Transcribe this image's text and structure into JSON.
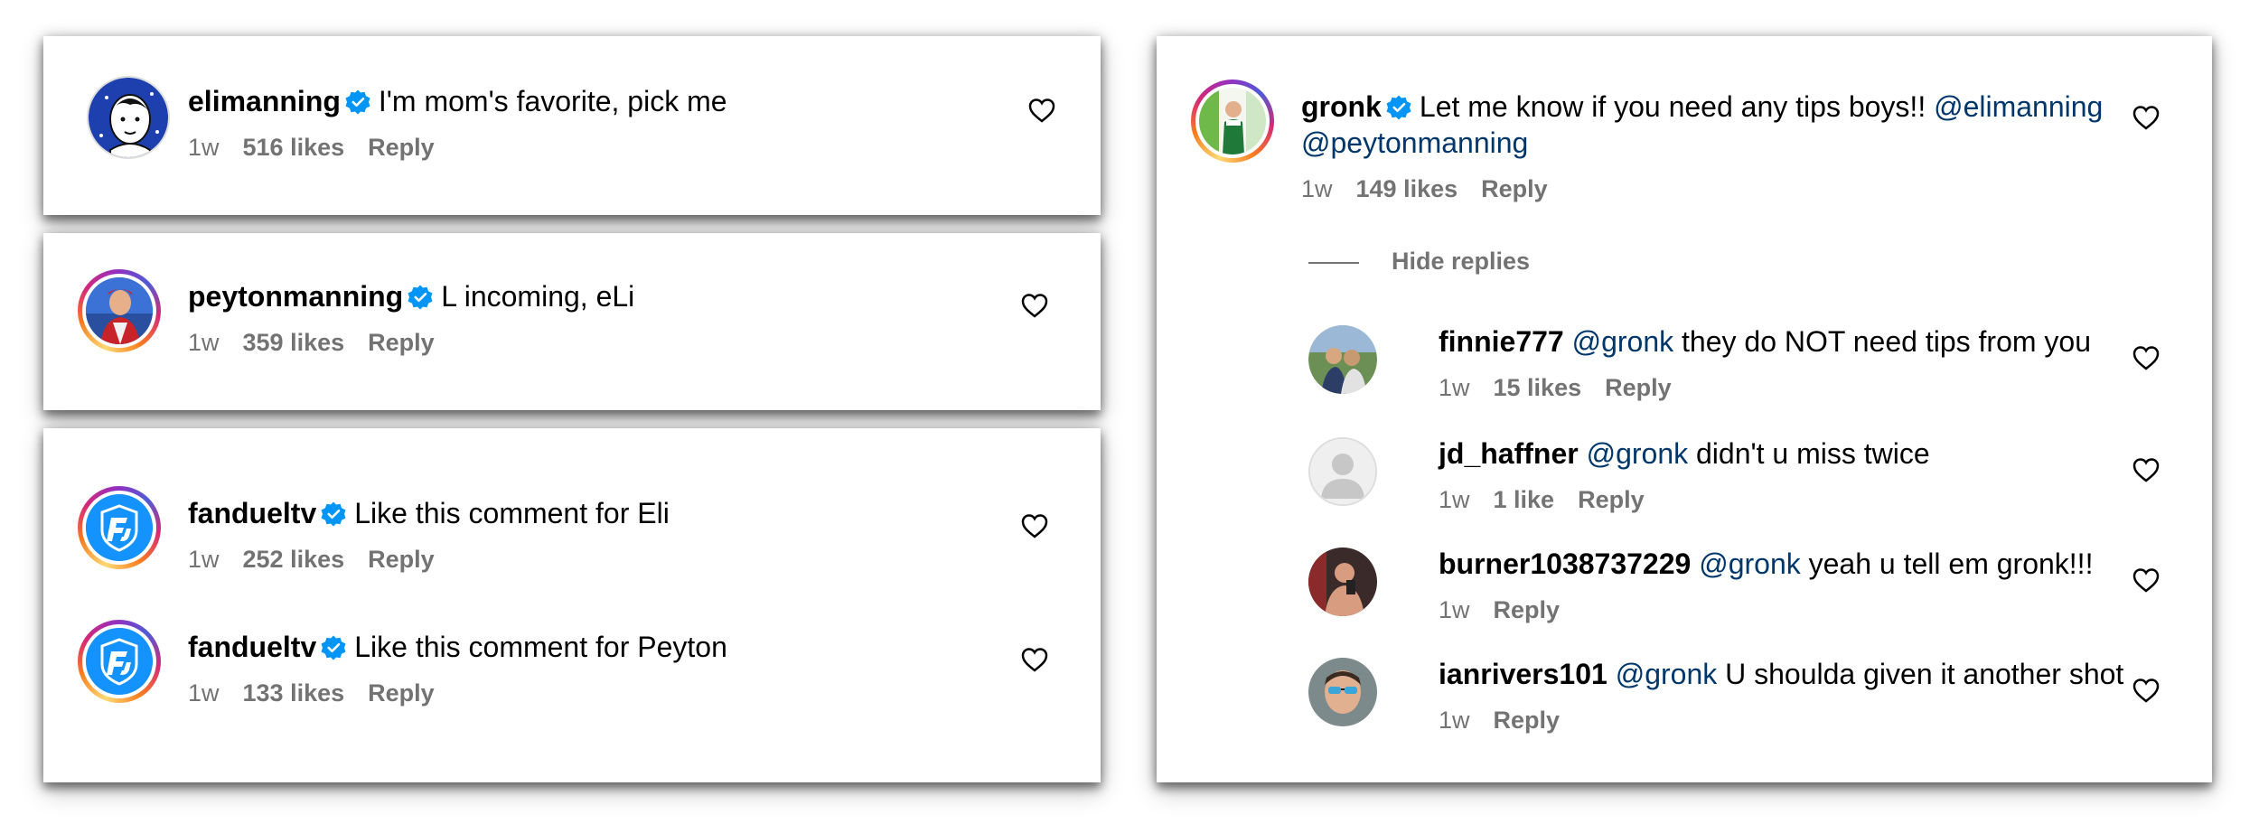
{
  "verified_color": "#0095f6",
  "mention_color": "#00376b",
  "left": [
    {
      "user": "elimanning",
      "text": "I'm mom's favorite, pick me",
      "time": "1w",
      "likes": "516 likes",
      "reply": "Reply"
    },
    {
      "user": "peytonmanning",
      "text": "L incoming, eLi",
      "time": "1w",
      "likes": "359 likes",
      "reply": "Reply"
    },
    {
      "user": "fandueltv",
      "text": "Like this comment for Eli",
      "time": "1w",
      "likes": "252 likes",
      "reply": "Reply"
    },
    {
      "user": "fandueltv",
      "text": "Like this comment for Peyton",
      "time": "1w",
      "likes": "133 likes",
      "reply": "Reply"
    }
  ],
  "gronk": {
    "user": "gronk",
    "text": "Let me know if you need any tips boys!!",
    "mention1": "@elimanning",
    "mention2": "@peytonmanning",
    "time": "1w",
    "likes": "149 likes",
    "reply": "Reply",
    "hide_replies": "Hide replies"
  },
  "replies": [
    {
      "user": "finnie777",
      "mention": "@gronk",
      "text": "they do NOT need tips from you",
      "time": "1w",
      "likes": "15 likes",
      "reply": "Reply"
    },
    {
      "user": "jd_haffner",
      "mention": "@gronk",
      "text": "didn't u miss twice",
      "time": "1w",
      "likes": "1 like",
      "reply": "Reply"
    },
    {
      "user": "burner1038737229",
      "mention": "@gronk",
      "text": "yeah u tell em gronk!!!",
      "time": "1w",
      "reply": "Reply"
    },
    {
      "user": "ianrivers101",
      "mention": "@gronk",
      "text": "U shoulda given it another shot",
      "time": "1w",
      "reply": "Reply"
    }
  ]
}
